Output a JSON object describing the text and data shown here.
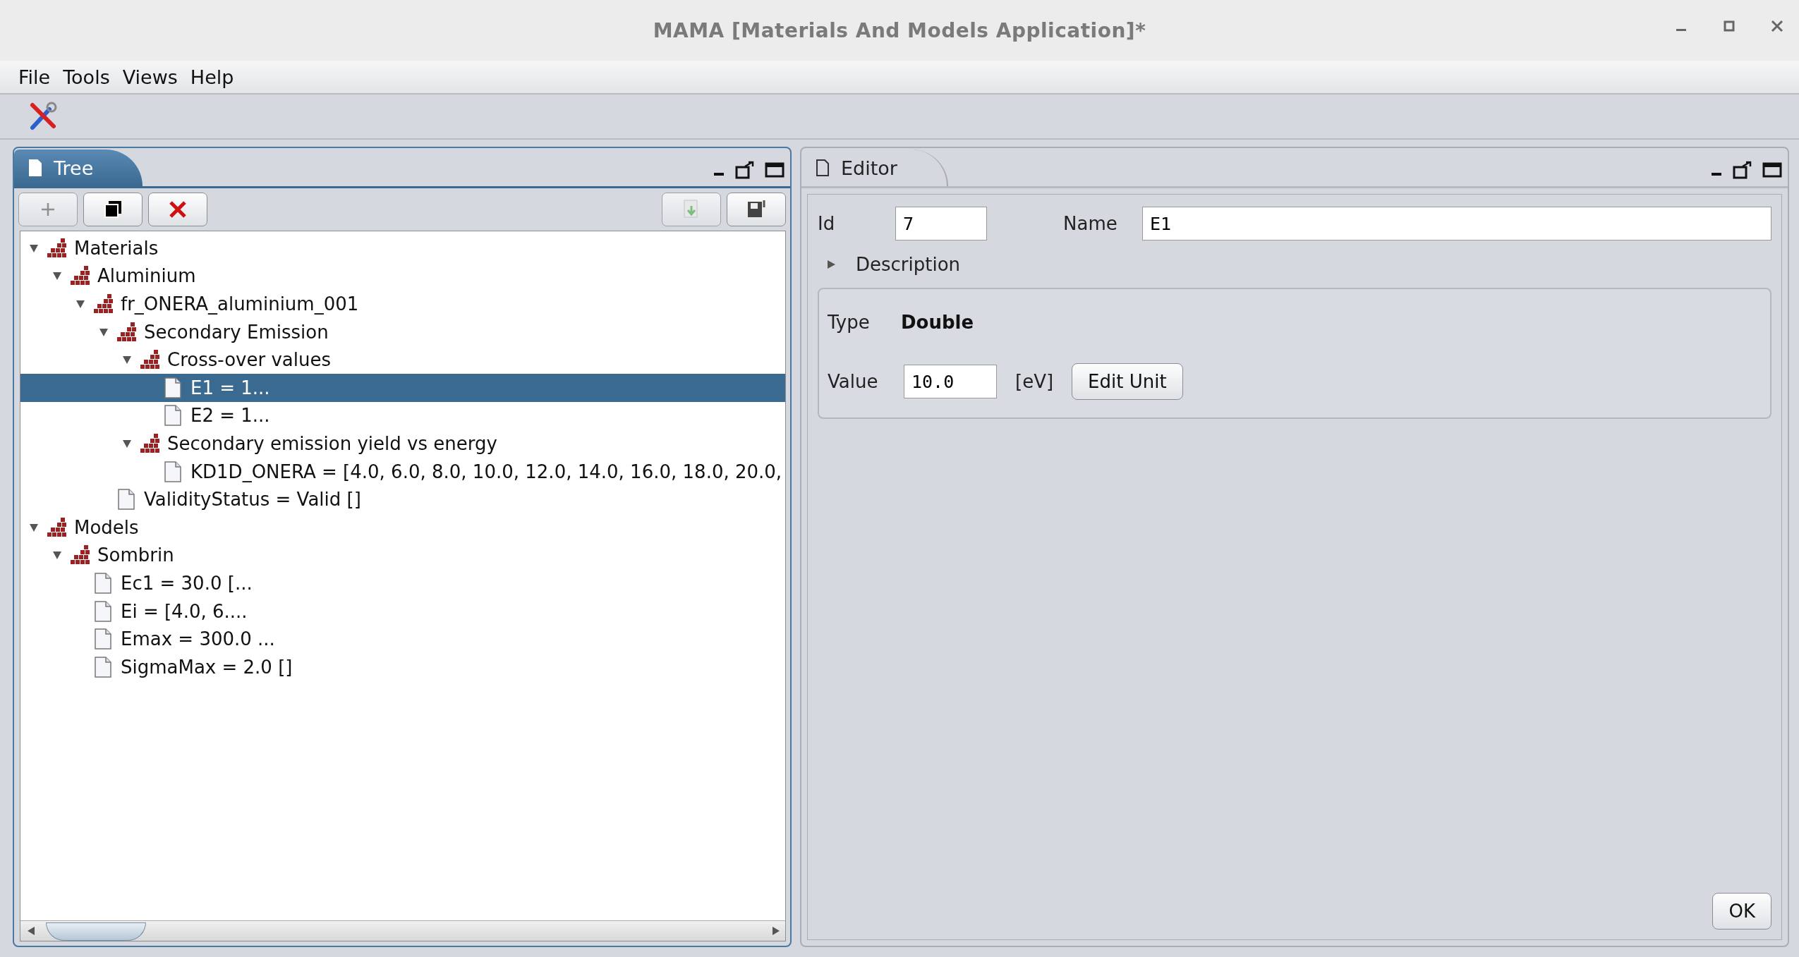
{
  "window": {
    "title": "MAMA [Materials And Models Application]*"
  },
  "menu": [
    "File",
    "Tools",
    "Views",
    "Help"
  ],
  "tree_panel": {
    "tab": "Tree",
    "focused": true,
    "toolbar": [
      {
        "kind": "add",
        "disabled": true
      },
      {
        "kind": "copy",
        "disabled": false
      },
      {
        "kind": "delete",
        "disabled": false
      },
      {
        "kind": "import",
        "disabled": true
      },
      {
        "kind": "save",
        "disabled": false
      }
    ],
    "items": [
      {
        "label": "Materials",
        "kind": "folder",
        "expanded": true,
        "selected": false,
        "children": [
          {
            "label": "Aluminium",
            "kind": "folder",
            "expanded": true,
            "selected": false,
            "children": [
              {
                "label": "fr_ONERA_aluminium_001",
                "kind": "folder",
                "expanded": true,
                "selected": false,
                "children": [
                  {
                    "label": "Secondary Emission",
                    "kind": "folder",
                    "expanded": true,
                    "selected": false,
                    "children": [
                      {
                        "label": "Cross-over values",
                        "kind": "folder",
                        "expanded": true,
                        "selected": false,
                        "children": [
                          {
                            "label": "E1 = 1...",
                            "kind": "leaf",
                            "selected": true
                          },
                          {
                            "label": "E2 = 1...",
                            "kind": "leaf",
                            "selected": false
                          }
                        ]
                      },
                      {
                        "label": "Secondary emission yield vs energy",
                        "kind": "folder",
                        "expanded": true,
                        "selected": false,
                        "children": [
                          {
                            "label": "KD1D_ONERA = [4.0, 6.0, 8.0, 10.0, 12.0, 14.0, 16.0, 18.0, 20.0,",
                            "kind": "leaf",
                            "selected": false
                          }
                        ]
                      }
                    ]
                  },
                  {
                    "label": "ValidityStatus = Valid []",
                    "kind": "leaf",
                    "selected": false
                  }
                ]
              }
            ]
          }
        ]
      },
      {
        "label": "Models",
        "kind": "folder",
        "expanded": true,
        "selected": false,
        "children": [
          {
            "label": "Sombrin",
            "kind": "folder",
            "expanded": true,
            "selected": false,
            "children": [
              {
                "label": "Ec1 = 30.0 [...",
                "kind": "leaf",
                "selected": false
              },
              {
                "label": "Ei = [4.0, 6....",
                "kind": "leaf",
                "selected": false
              },
              {
                "label": "Emax = 300.0 ...",
                "kind": "leaf",
                "selected": false
              },
              {
                "label": "SigmaMax = 2.0 []",
                "kind": "leaf",
                "selected": false
              }
            ]
          }
        ]
      }
    ]
  },
  "editor_panel": {
    "tab": "Editor",
    "focused": false,
    "id": {
      "label": "Id",
      "value": "7"
    },
    "name": {
      "label": "Name",
      "value": "E1"
    },
    "description": {
      "label": "Description",
      "expanded": false
    },
    "type": {
      "label": "Type",
      "value": "Double"
    },
    "value": {
      "label": "Value",
      "value": "10.0",
      "unit": "[eV]",
      "button": "Edit Unit"
    },
    "ok": "OK"
  }
}
